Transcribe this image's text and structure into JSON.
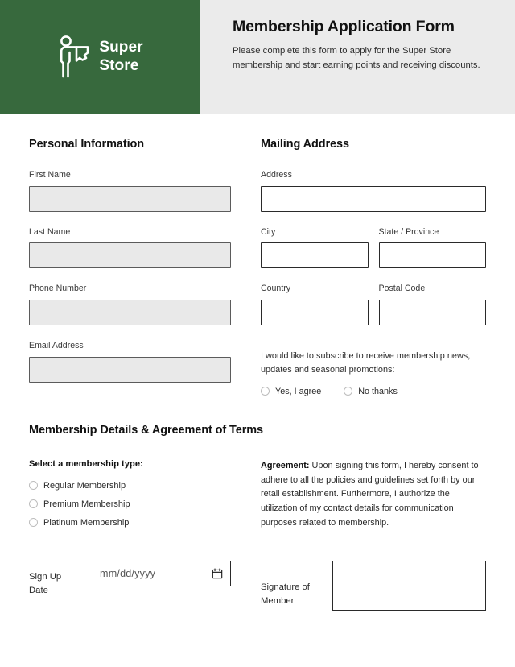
{
  "header": {
    "brand": {
      "logo_icon": "person-figure-icon",
      "line1": "Super",
      "line2": "Store",
      "bg_color": "#37693d"
    },
    "title": "Membership Application Form",
    "subtitle": "Please complete this form to apply for the Super Store membership and start earning points and receiving discounts.",
    "bg_color": "#ebebeb"
  },
  "personal": {
    "section_title": "Personal Information",
    "fields": [
      {
        "label": "First Name",
        "value": ""
      },
      {
        "label": "Last Name",
        "value": ""
      },
      {
        "label": "Phone Number",
        "value": ""
      },
      {
        "label": "Email Address",
        "value": ""
      }
    ]
  },
  "mailing": {
    "section_title": "Mailing Address",
    "address": {
      "label": "Address",
      "value": ""
    },
    "city": {
      "label": "City",
      "value": ""
    },
    "state": {
      "label": "State / Province",
      "value": ""
    },
    "country": {
      "label": "Country",
      "value": ""
    },
    "postal": {
      "label": "Postal Code",
      "value": ""
    },
    "subscribe": {
      "text": "I would like to subscribe to receive membership news, updates and seasonal promotions:",
      "options": [
        {
          "label": "Yes, I agree",
          "selected": false
        },
        {
          "label": "No thanks",
          "selected": false
        }
      ]
    }
  },
  "details": {
    "section_title": "Membership Details & Agreement of Terms",
    "membership_subhead": "Select a membership type:",
    "membership_options": [
      {
        "label": "Regular Membership",
        "selected": false
      },
      {
        "label": "Premium Membership",
        "selected": false
      },
      {
        "label": "Platinum Membership",
        "selected": false
      }
    ],
    "agreement_label": "Agreement:",
    "agreement_text": " Upon signing this form, I hereby consent to adhere to all the policies and guidelines set forth by our retail establishment. Furthermore, I authorize the utilization of my contact details for communication purposes related to membership."
  },
  "signoff": {
    "date_label": "Sign Up Date",
    "date_placeholder": "mm/dd/yyyy",
    "date_value": "",
    "calendar_icon": "calendar-icon",
    "signature_label": "Signature of Member",
    "signature_value": ""
  }
}
